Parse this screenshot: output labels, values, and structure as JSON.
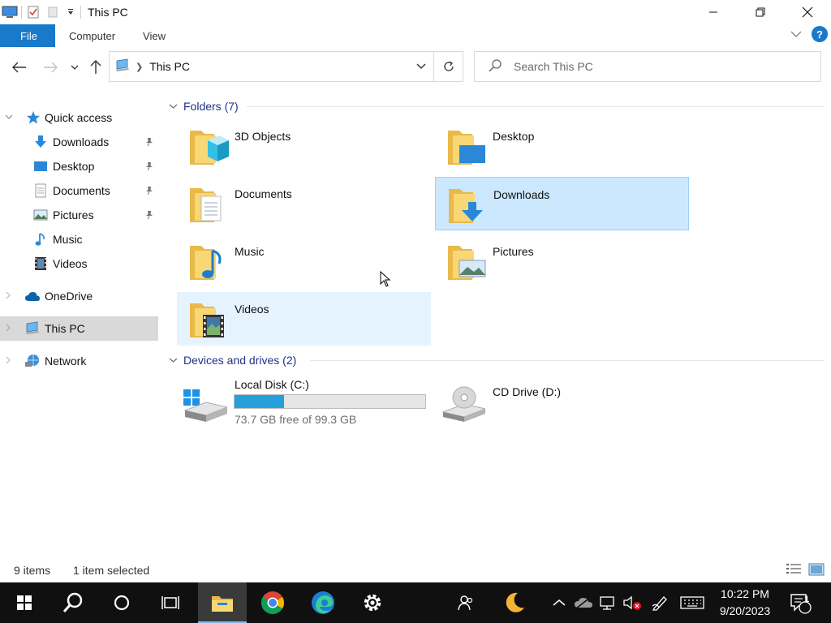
{
  "window": {
    "title": "This PC"
  },
  "ribbon": {
    "tabs": [
      {
        "label": "File"
      },
      {
        "label": "Computer"
      },
      {
        "label": "View"
      }
    ]
  },
  "address": {
    "path": "This PC"
  },
  "search": {
    "placeholder": "Search This PC"
  },
  "nav_pane": {
    "quick_access": "Quick access",
    "quick_items": [
      "Downloads",
      "Desktop",
      "Documents",
      "Pictures",
      "Music",
      "Videos"
    ],
    "onedrive": "OneDrive",
    "this_pc": "This PC",
    "network": "Network"
  },
  "content": {
    "folders_header": "Folders (7)",
    "folders": [
      {
        "name": "3D Objects",
        "icon": "3d-objects-folder-icon"
      },
      {
        "name": "Desktop",
        "icon": "desktop-folder-icon"
      },
      {
        "name": "Documents",
        "icon": "documents-folder-icon"
      },
      {
        "name": "Downloads",
        "icon": "downloads-folder-icon",
        "selected": true
      },
      {
        "name": "Music",
        "icon": "music-folder-icon"
      },
      {
        "name": "Pictures",
        "icon": "pictures-folder-icon"
      },
      {
        "name": "Videos",
        "icon": "videos-folder-icon",
        "hovered": true
      }
    ],
    "devices_header": "Devices and drives (2)",
    "drives": [
      {
        "name": "Local Disk (C:)",
        "free": "73.7 GB free of 99.3 GB",
        "used_fraction": 0.258
      },
      {
        "name": "CD Drive (D:)"
      }
    ]
  },
  "status": {
    "items": "9 items",
    "selected": "1 item selected"
  },
  "taskbar": {
    "time": "10:22 PM",
    "date": "9/20/2023",
    "notification_count": "1"
  },
  "colors": {
    "accent": "#1979ca",
    "selection_bg": "#cce8ff",
    "hover_bg": "#e5f3ff",
    "drive_fill": "#26a0da",
    "group_header": "#1e3287",
    "taskbar_bg": "#101010"
  }
}
